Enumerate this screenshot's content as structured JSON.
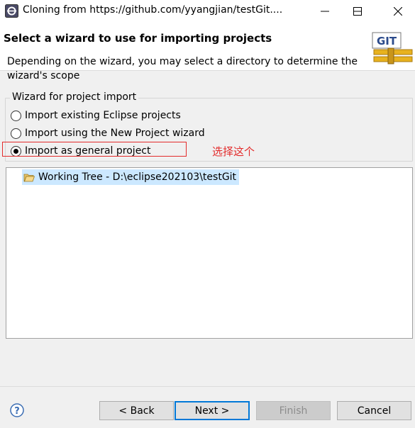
{
  "window": {
    "title": "Cloning from https://github.com/yyangjian/testGit...."
  },
  "header": {
    "title": "Select a wizard to use for importing projects",
    "description": "Depending on the wizard, you may select a directory to determine the wizard's scope",
    "logo_text": "GIT"
  },
  "wizard_group": {
    "label": "Wizard for project import",
    "options": [
      {
        "label": "Import existing Eclipse projects",
        "selected": false
      },
      {
        "label": "Import using the New Project wizard",
        "selected": false
      },
      {
        "label": "Import as general project",
        "selected": true
      }
    ]
  },
  "annotation": {
    "text": "选择这个",
    "color": "#e32b2b"
  },
  "tree": {
    "items": [
      {
        "label": "Working Tree - D:\\eclipse202103\\testGit"
      }
    ]
  },
  "buttons": {
    "back": "< Back",
    "next": "Next >",
    "finish": "Finish",
    "cancel": "Cancel"
  },
  "colors": {
    "selection": "#cce8ff",
    "default_button_border": "#0078d7"
  }
}
